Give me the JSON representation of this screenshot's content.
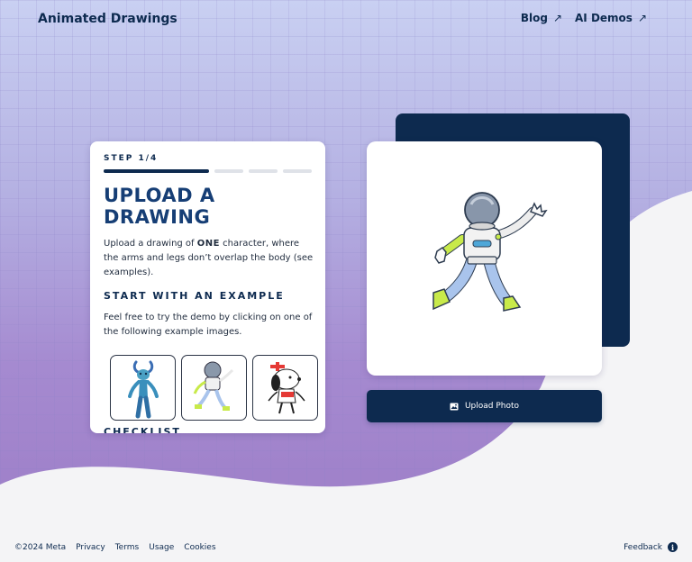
{
  "header": {
    "brand": "Animated Drawings",
    "nav": [
      {
        "label": "Blog",
        "arrow": "↗"
      },
      {
        "label": "AI Demos",
        "arrow": "↗"
      }
    ]
  },
  "card": {
    "step": "STEP 1/4",
    "progress": {
      "current": 1,
      "total": 4
    },
    "title_line1": "UPLOAD A",
    "title_line2": "DRAWING",
    "desc_prefix": "Upload a drawing of ",
    "desc_bold": "ONE",
    "desc_suffix": " character, where the arms and legs don’t overlap the body (see examples).",
    "example_heading": "START WITH AN EXAMPLE",
    "example_desc": "Feel free to try the demo by clicking on one of the following example images.",
    "examples": [
      "blue-figure",
      "astronaut",
      "dog"
    ],
    "checklist_heading": "CHECKLIST"
  },
  "upload": {
    "button_label": "Upload Photo",
    "icon": "image-icon"
  },
  "footer": {
    "copyright": "©2024 Meta",
    "links": [
      "Privacy",
      "Terms",
      "Usage",
      "Cookies"
    ],
    "feedback": "Feedback",
    "feedback_icon": "i"
  },
  "colors": {
    "navy": "#0d2a4f",
    "title_blue": "#163e75",
    "lime": "#c8ea4a",
    "light_blue": "#a9c4ec"
  }
}
